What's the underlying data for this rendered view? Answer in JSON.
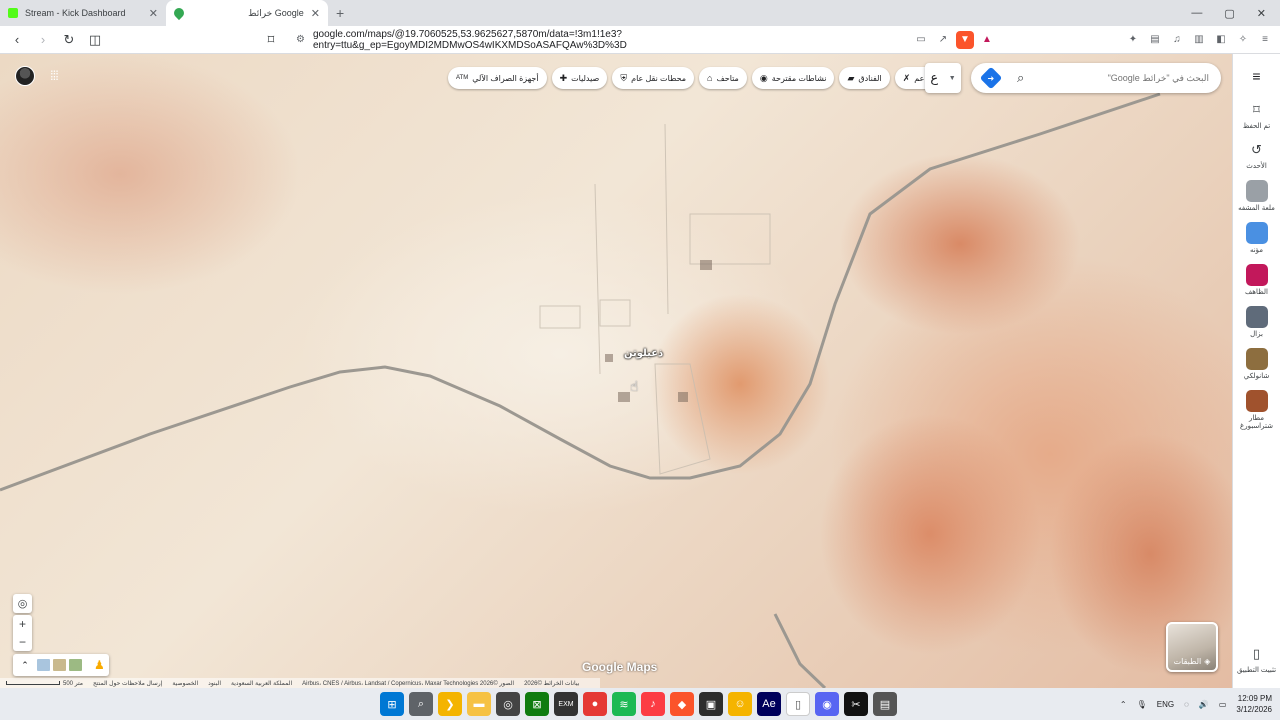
{
  "tabs": [
    {
      "title": "Stream - Kick Dashboard",
      "favicon_color": "#53fc18",
      "active": false
    },
    {
      "title": "خرائط Google",
      "favicon_color": "#34a853",
      "active": true
    }
  ],
  "new_tab_glyph": "+",
  "window_controls": [
    "—",
    "▢",
    "✕"
  ],
  "address": {
    "url": "google.com/maps/@19.7060525,53.9625627,5870m/data=!3m1!1e3?entry=ttu&g_ep=EgoyMDI2MDMwOS4wIKXMDSoASAFQAw%3D%3D"
  },
  "map": {
    "search_placeholder": "البحث في \"خرائط Google\"",
    "lang_label": "ع",
    "chips": [
      {
        "icon": "atm-icon",
        "glyph": "ATM",
        "label": "أجهزة الصراف الآلي"
      },
      {
        "icon": "pharmacy-icon",
        "glyph": "✚",
        "label": "صيدليات"
      },
      {
        "icon": "transit-icon",
        "glyph": "⛨",
        "label": "محطات نقل عام"
      },
      {
        "icon": "museum-icon",
        "glyph": "⌂",
        "label": "متاحف"
      },
      {
        "icon": "camera-icon",
        "glyph": "◉",
        "label": "نشاطات مقترحة"
      },
      {
        "icon": "hotel-icon",
        "glyph": "▰",
        "label": "الفنادق"
      },
      {
        "icon": "restaurant-icon",
        "glyph": "✗",
        "label": "مطاعم"
      }
    ],
    "place_label": "ذعيلوتن",
    "logo_text": "Google Maps",
    "layers_label": "الطبقات",
    "footer": {
      "scale_label": "500 متر",
      "items": [
        "بيانات الخرائط ©2026",
        "الصور ©2026 Airbus، CNES / Airbus، Landsat / Copernicus، Maxar Technologies",
        "المملكة العربية السعودية",
        "البنود",
        "الخصوصية",
        "إرسال ملاحظات حول المنتج"
      ]
    }
  },
  "sidebar": {
    "items": [
      {
        "icon": "bookmark-icon",
        "glyph": "⌑",
        "label": "تم الحفظ"
      },
      {
        "icon": "history-icon",
        "glyph": "↺",
        "label": "الأحدث"
      },
      {
        "icon": "place-thumb",
        "thumb_color": "#9aa0a6",
        "label": "ملعة المشفه"
      },
      {
        "icon": "place-thumb",
        "thumb_color": "#4a90e2",
        "label": "مؤنه"
      },
      {
        "icon": "place-thumb",
        "thumb_color": "#c2185b",
        "label": "الظاهف"
      },
      {
        "icon": "place-thumb",
        "thumb_color": "#5f6b7a",
        "label": "بزال"
      },
      {
        "icon": "place-thumb",
        "thumb_color": "#8d6e3f",
        "label": "شانولكي"
      },
      {
        "icon": "place-thumb",
        "thumb_color": "#a0522d",
        "label": "مطار شتراسبورغ"
      }
    ],
    "bottom": {
      "icon": "phone-icon",
      "glyph": "▯",
      "label": "تثبيت التطبيق"
    }
  },
  "taskbar": {
    "apps": [
      {
        "name": "windows-start-icon",
        "color": "#0078d4",
        "glyph": "⊞"
      },
      {
        "name": "search-icon",
        "color": "#5f6368",
        "glyph": "⌕"
      },
      {
        "name": "chevron-app-icon",
        "color": "#f4b400",
        "glyph": "❯"
      },
      {
        "name": "folder-icon",
        "color": "#f6c244",
        "glyph": "▬"
      },
      {
        "name": "chatgpt-icon",
        "color": "#444",
        "glyph": "◎"
      },
      {
        "name": "xbox-icon",
        "color": "#107c10",
        "glyph": "⊠"
      },
      {
        "name": "exm-icon",
        "color": "#333",
        "glyph": "EXM"
      },
      {
        "name": "record-icon",
        "color": "#e53935",
        "glyph": "●"
      },
      {
        "name": "spotify-icon",
        "color": "#1db954",
        "glyph": "≋"
      },
      {
        "name": "music-icon",
        "color": "#fc3c44",
        "glyph": "♪"
      },
      {
        "name": "brave-icon",
        "color": "#fb542b",
        "glyph": "◆"
      },
      {
        "name": "terminal-icon",
        "color": "#2d2d2d",
        "glyph": "▣"
      },
      {
        "name": "discord-face-icon",
        "color": "#f5b400",
        "glyph": "☺"
      },
      {
        "name": "after-effects-icon",
        "color": "#00005b",
        "glyph": "Ae"
      },
      {
        "name": "document-icon",
        "color": "#ffffff",
        "glyph": "▯"
      },
      {
        "name": "discord-icon",
        "color": "#5865f2",
        "glyph": "◉"
      },
      {
        "name": "capcut-icon",
        "color": "#111",
        "glyph": "✂"
      },
      {
        "name": "app-icon",
        "color": "#555",
        "glyph": "▤"
      }
    ],
    "tray_lang": "ENG",
    "time": "12:09 PM",
    "date": "3/12/2026"
  }
}
